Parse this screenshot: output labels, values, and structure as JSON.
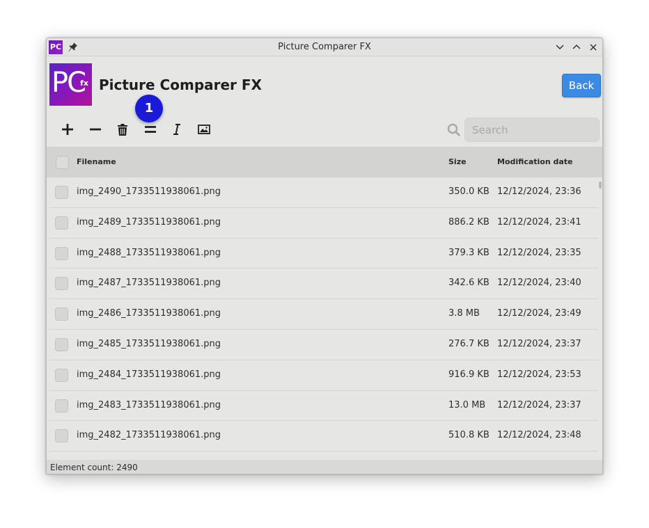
{
  "window": {
    "title": "Picture Comparer FX",
    "app_icon_text": "PC"
  },
  "header": {
    "logo_main": "PC",
    "logo_sub": "fx",
    "title": "Picture Comparer FX",
    "back_label": "Back"
  },
  "toolbar": {
    "tools": [
      "plus-icon",
      "minus-icon",
      "trash-icon",
      "equals-icon",
      "italic-icon",
      "image-icon"
    ],
    "badge_number": "1"
  },
  "search": {
    "placeholder": "Search",
    "value": ""
  },
  "table": {
    "columns": {
      "filename": "Filename",
      "size": "Size",
      "date": "Modification date"
    },
    "rows": [
      {
        "name": "img_2490_1733511938061.png",
        "size": "350.0 KB",
        "date": "12/12/2024, 23:36"
      },
      {
        "name": "img_2489_1733511938061.png",
        "size": "886.2 KB",
        "date": "12/12/2024, 23:41"
      },
      {
        "name": "img_2488_1733511938061.png",
        "size": "379.3 KB",
        "date": "12/12/2024, 23:35"
      },
      {
        "name": "img_2487_1733511938061.png",
        "size": "342.6 KB",
        "date": "12/12/2024, 23:40"
      },
      {
        "name": "img_2486_1733511938061.png",
        "size": "3.8 MB",
        "date": "12/12/2024, 23:49"
      },
      {
        "name": "img_2485_1733511938061.png",
        "size": "276.7 KB",
        "date": "12/12/2024, 23:37"
      },
      {
        "name": "img_2484_1733511938061.png",
        "size": "916.9 KB",
        "date": "12/12/2024, 23:53"
      },
      {
        "name": "img_2483_1733511938061.png",
        "size": "13.0 MB",
        "date": "12/12/2024, 23:37"
      },
      {
        "name": "img_2482_1733511938061.png",
        "size": "510.8 KB",
        "date": "12/12/2024, 23:48"
      }
    ]
  },
  "status": {
    "text": "Element count: 2490"
  },
  "colors": {
    "accent": "#3c8be3",
    "badge": "#1a1ad8",
    "logo": "#7a1cc0"
  }
}
